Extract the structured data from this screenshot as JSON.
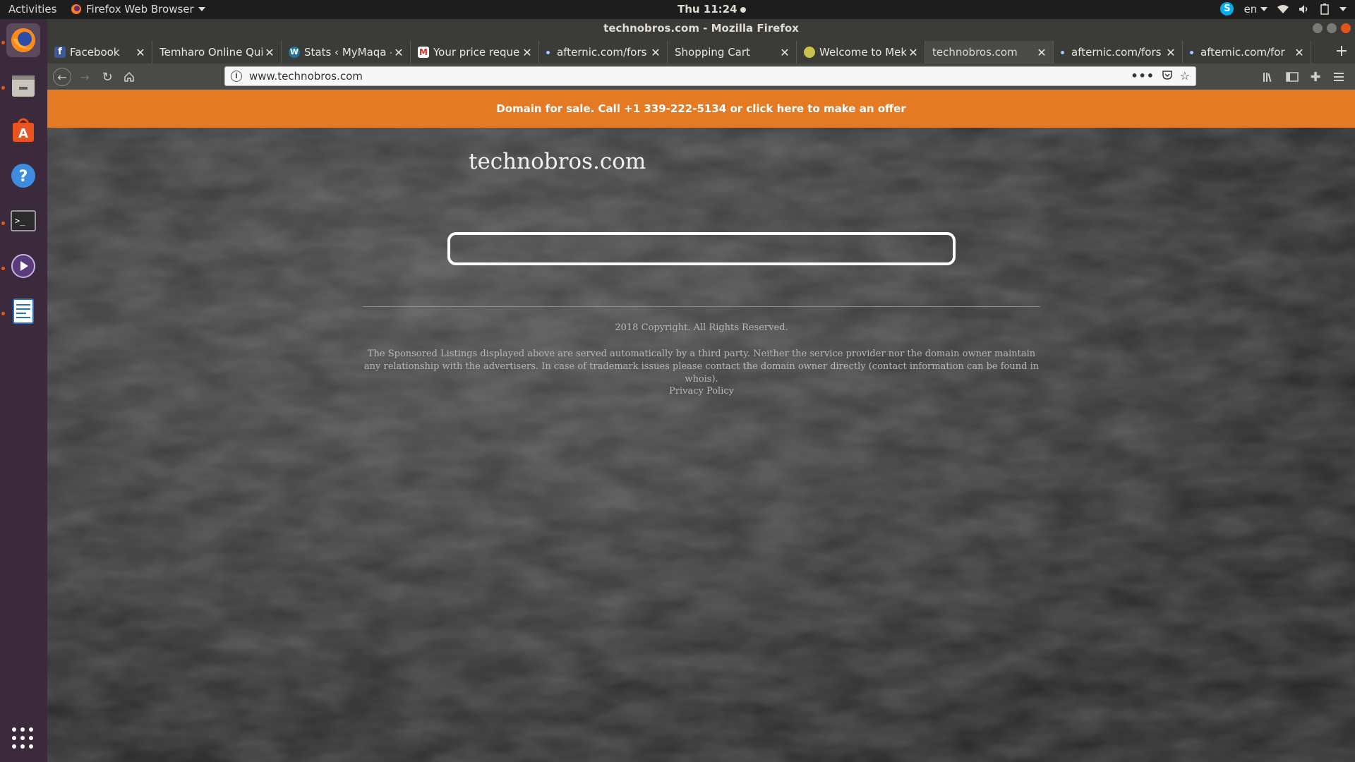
{
  "topbar": {
    "activities": "Activities",
    "app_name": "Firefox Web Browser",
    "clock": "Thu 11:24",
    "lang": "en"
  },
  "window": {
    "title": "technobros.com - Mozilla Firefox"
  },
  "tabs": [
    {
      "label": "Facebook",
      "favicon": "facebook-icon"
    },
    {
      "label": "Temharo Online Quiz",
      "favicon": "none"
    },
    {
      "label": "Stats ‹ MyMaqa —",
      "favicon": "wordpress-icon"
    },
    {
      "label": "Your price request",
      "favicon": "gmail-icon"
    },
    {
      "label": "afternic.com/fors",
      "favicon": "loading-dot"
    },
    {
      "label": "Shopping Cart",
      "favicon": "none"
    },
    {
      "label": "Welcome to Meke",
      "favicon": "globe-icon"
    },
    {
      "label": "technobros.com",
      "favicon": "none",
      "active": true
    },
    {
      "label": "afternic.com/fors",
      "favicon": "loading-dot"
    },
    {
      "label": "afternic.com/for",
      "favicon": "loading-dot"
    }
  ],
  "nav": {
    "url": "www.technobros.com"
  },
  "page": {
    "banner": "Domain for sale. Call +1 339-222-5134 or click here to make an offer",
    "site_name": "technobros.com",
    "search_value": "",
    "copyright": "2018 Copyright. All Rights Reserved.",
    "disclaimer": "The Sponsored Listings displayed above are served automatically by a third party. Neither the service provider nor the domain owner maintain any relationship with the advertisers. In case of trademark issues please contact the domain owner directly (contact information can be found in whois).",
    "privacy": "Privacy Policy"
  },
  "colors": {
    "banner": "#e57a24",
    "launcher": "#3b2a3c",
    "page_bg": "#333333"
  }
}
